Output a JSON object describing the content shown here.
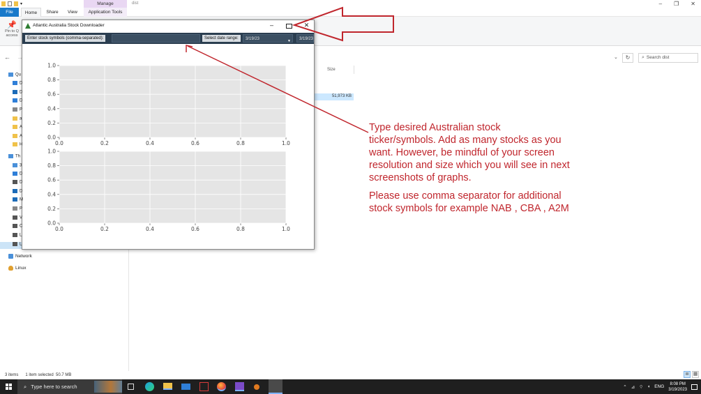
{
  "explorer": {
    "context_tab": "Manage",
    "window_title": "dist",
    "ribbon_tabs": {
      "file": "File",
      "home": "Home",
      "share": "Share",
      "view": "View",
      "app_tools": "Application Tools"
    },
    "pin_label": "Pin to Q\naccess",
    "search_placeholder": "Search dist",
    "column_size": "Size",
    "selected_file_size": "51,973 KB",
    "nav_items": [
      "Qu",
      "D",
      "D",
      "D",
      "P",
      "a",
      "A",
      "A",
      "H",
      "Th",
      "3",
      "D",
      "D",
      "D",
      "M",
      "P",
      "V",
      "C",
      "L",
      "L"
    ],
    "network": "Network",
    "linux": "Linux",
    "status_items": "3 items",
    "status_selected": "1 item selected  50.7 MB"
  },
  "app": {
    "title": "Atlantic Australia Stock Downloader",
    "symbols_label": "Enter stock symbols (comma-separated):",
    "symbols_value": "",
    "date_range_label": "Select date range:",
    "start_date": "3/19/23",
    "end_date": "3/19/23",
    "colors": {
      "toolbar": "#2b3e50",
      "plot_bg": "#e5e5e5"
    }
  },
  "chart_data": [
    {
      "type": "line",
      "series": [],
      "xlim": [
        0.0,
        1.0
      ],
      "ylim": [
        0.0,
        1.0
      ],
      "xticks": [
        "0.0",
        "0.2",
        "0.4",
        "0.6",
        "0.8",
        "1.0"
      ],
      "yticks": [
        "0.0",
        "0.2",
        "0.4",
        "0.6",
        "0.8",
        "1.0"
      ],
      "grid": true
    },
    {
      "type": "line",
      "series": [],
      "xlim": [
        0.0,
        1.0
      ],
      "ylim": [
        0.0,
        1.0
      ],
      "xticks": [
        "0.0",
        "0.2",
        "0.4",
        "0.6",
        "0.8",
        "1.0"
      ],
      "yticks": [
        "0.0",
        "0.2",
        "0.4",
        "0.6",
        "0.8",
        "1.0"
      ],
      "grid": true
    }
  ],
  "annotations": {
    "main": [
      "Type desired Australian stock",
      "ticker/symbols. Add as many stocks as you",
      "want. However, be mindful of your screen",
      "resolution and size which you will see in next",
      "screenshots of graphs."
    ],
    "secondary": [
      "Please use comma separator for additional",
      "stock symbols for example NAB , CBA , A2M"
    ],
    "color": "#c0262d"
  },
  "taskbar": {
    "search_placeholder": "Type here to search",
    "language": "ENG",
    "time": "8:08 PM",
    "date": "3/19/2023"
  }
}
